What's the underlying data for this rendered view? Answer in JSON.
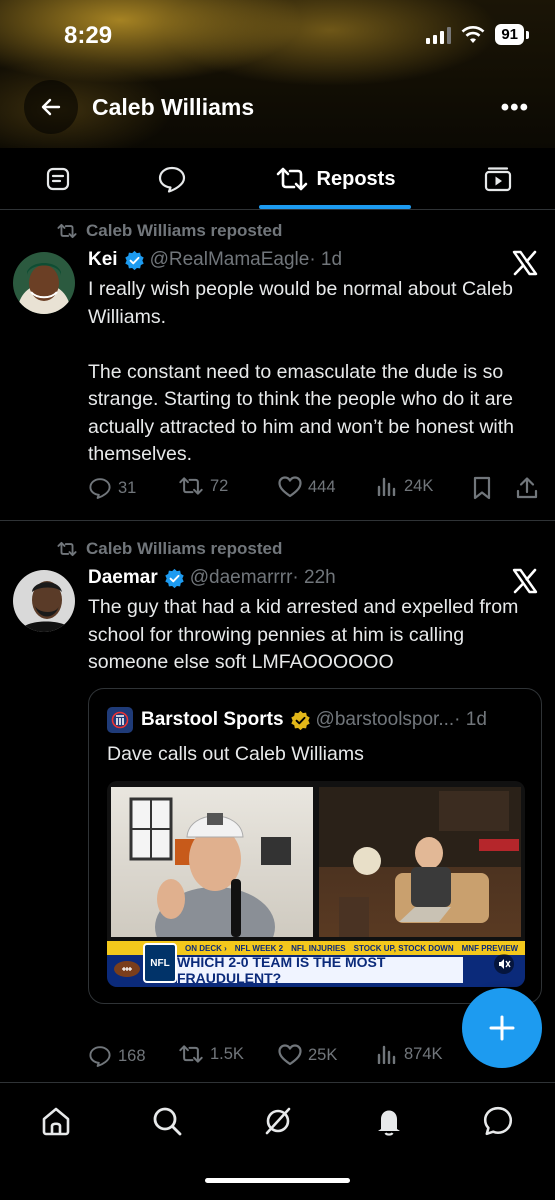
{
  "status_bar": {
    "time": "8:29",
    "battery": "91"
  },
  "header": {
    "title": "Caleb Williams"
  },
  "tabs": [
    {
      "label": "",
      "icon": "article-icon"
    },
    {
      "label": "",
      "icon": "chat-bubble-icon"
    },
    {
      "label": "Reposts",
      "icon": "repost-icon",
      "active": true
    },
    {
      "label": "",
      "icon": "video-icon"
    }
  ],
  "posts": [
    {
      "repost_label": "Caleb Williams reposted",
      "name": "Kei",
      "handle": "@RealMamaEagle",
      "time": "· 1d",
      "text": "I really wish people would be normal about Caleb Williams.\n\nThe constant need to emasculate the dude is so strange. Starting to think the people who do it are actually attracted to him and won’t be honest with themselves.",
      "replies": "31",
      "reposts": "72",
      "likes": "444",
      "views": "24K"
    },
    {
      "repost_label": "Caleb Williams reposted",
      "name": "Daemar",
      "handle": "@daemarrrr",
      "time": "· 22h",
      "text": "The guy that had a kid arrested and expelled from school for throwing pennies at him is calling someone else soft LMFAOOOOOO",
      "replies": "168",
      "reposts": "1.5K",
      "likes": "25K",
      "views": "874K",
      "quote": {
        "name": "Barstool Sports",
        "handle": "@barstoolspor...",
        "time": "· 1d",
        "text": "Dave calls out Caleb Williams",
        "media": {
          "ticker_items": [
            "ON DECK ›",
            "NFL WEEK 2",
            "NFL INJURIES",
            "STOCK UP, STOCK DOWN",
            "MNF PREVIEW"
          ],
          "headline": "WHICH 2-0 TEAM IS THE MOST FRAUDULENT?",
          "badge": "NFL"
        }
      }
    }
  ],
  "colors": {
    "accent": "#1d9bf0",
    "muted": "#71767b",
    "verified_gold": "#e2b719"
  }
}
